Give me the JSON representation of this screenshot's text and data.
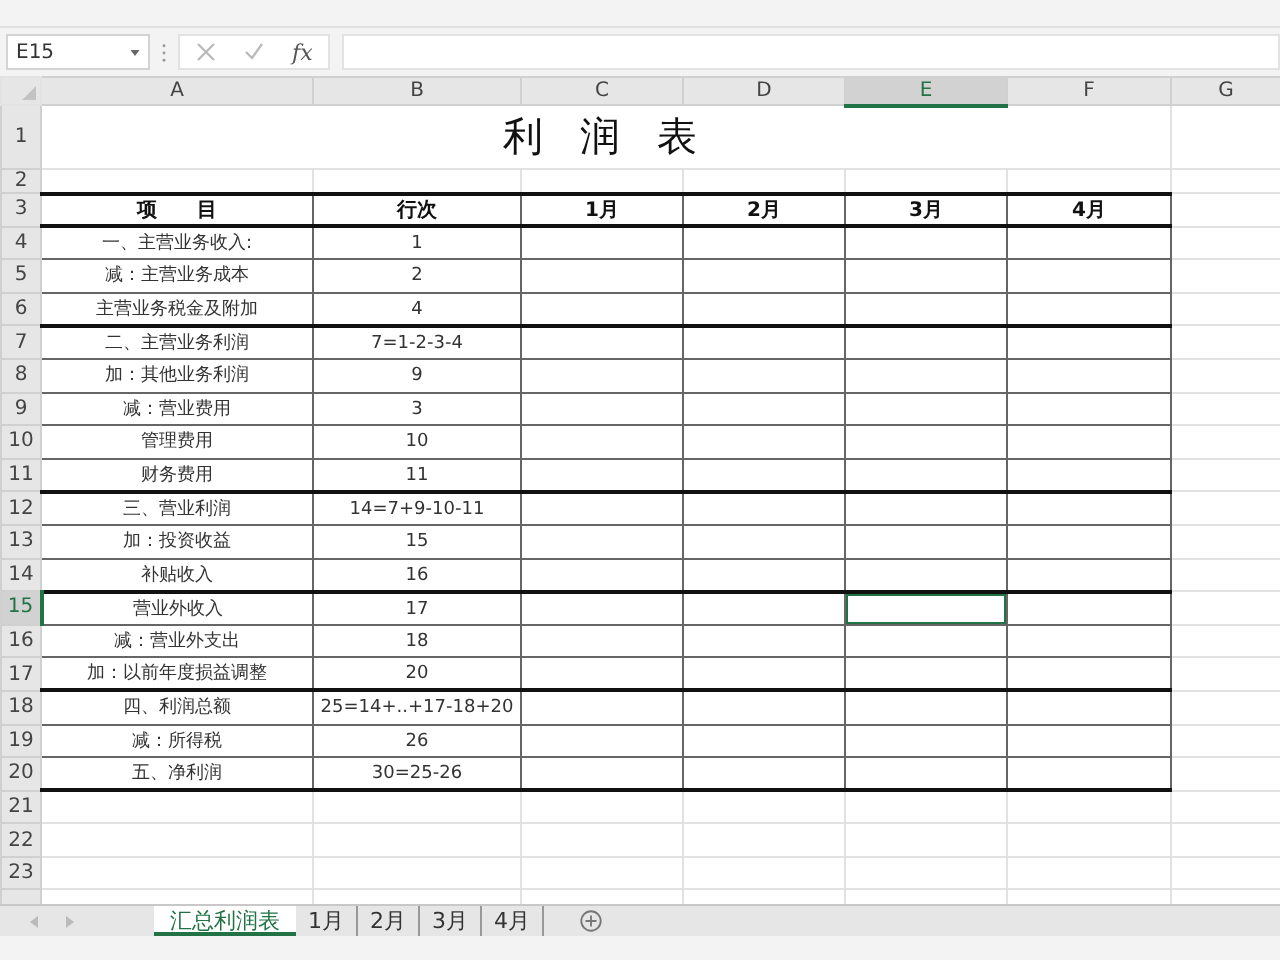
{
  "name_box": {
    "value": "E15"
  },
  "formula_bar": {
    "function_label": "fx"
  },
  "columns": [
    {
      "label": "A",
      "selected": false
    },
    {
      "label": "B",
      "selected": false
    },
    {
      "label": "C",
      "selected": false
    },
    {
      "label": "D",
      "selected": false
    },
    {
      "label": "E",
      "selected": true
    },
    {
      "label": "F",
      "selected": false
    },
    {
      "label": "G",
      "selected": false
    }
  ],
  "row_headers": [
    {
      "label": "1",
      "selected": false
    },
    {
      "label": "2",
      "selected": false
    },
    {
      "label": "3",
      "selected": false
    },
    {
      "label": "4",
      "selected": false
    },
    {
      "label": "5",
      "selected": false
    },
    {
      "label": "6",
      "selected": false
    },
    {
      "label": "7",
      "selected": false
    },
    {
      "label": "8",
      "selected": false
    },
    {
      "label": "9",
      "selected": false
    },
    {
      "label": "10",
      "selected": false
    },
    {
      "label": "11",
      "selected": false
    },
    {
      "label": "12",
      "selected": false
    },
    {
      "label": "13",
      "selected": false
    },
    {
      "label": "14",
      "selected": false
    },
    {
      "label": "15",
      "selected": true
    },
    {
      "label": "16",
      "selected": false
    },
    {
      "label": "17",
      "selected": false
    },
    {
      "label": "18",
      "selected": false
    },
    {
      "label": "19",
      "selected": false
    },
    {
      "label": "20",
      "selected": false
    },
    {
      "label": "21",
      "selected": false
    },
    {
      "label": "22",
      "selected": false
    },
    {
      "label": "23",
      "selected": false
    }
  ],
  "sheet": {
    "title": "利 润 表",
    "header": [
      "项　　目",
      "行次",
      "1月",
      "2月",
      "3月",
      "4月"
    ],
    "items": [
      {
        "label": "一、主营业务收入:",
        "line": "1",
        "border_top": true
      },
      {
        "label": "减：主营业务成本",
        "line": "2",
        "border_top": false
      },
      {
        "label": "主营业务税金及附加",
        "line": "4",
        "border_top": false
      },
      {
        "label": "二、主营业务利润",
        "line": "7=1-2-3-4",
        "border_top": true
      },
      {
        "label": "加：其他业务利润",
        "line": "9",
        "border_top": false
      },
      {
        "label": "减：营业费用",
        "line": "3",
        "border_top": false
      },
      {
        "label": "管理费用",
        "line": "10",
        "border_top": false
      },
      {
        "label": "财务费用",
        "line": "11",
        "border_top": false
      },
      {
        "label": "三、营业利润",
        "line": "14=7+9-10-11",
        "border_top": true
      },
      {
        "label": "加：投资收益",
        "line": "15",
        "border_top": false
      },
      {
        "label": "补贴收入",
        "line": "16",
        "border_top": false
      },
      {
        "label": "营业外收入",
        "line": "17",
        "border_top": true
      },
      {
        "label": "减：营业外支出",
        "line": "18",
        "border_top": false
      },
      {
        "label": "加：以前年度损益调整",
        "line": "20",
        "border_top": false
      },
      {
        "label": "四、利润总额",
        "line": "25=14+..+17-18+20",
        "border_top": true
      },
      {
        "label": "减：所得税",
        "line": "26",
        "border_top": false
      },
      {
        "label": "五、净利润",
        "line": "30=25-26",
        "border_top": false
      }
    ]
  },
  "sheet_tabs": [
    {
      "label": "汇总利润表",
      "selected": true
    },
    {
      "label": "1月",
      "selected": false
    },
    {
      "label": "2月",
      "selected": false
    },
    {
      "label": "3月",
      "selected": false
    },
    {
      "label": "4月",
      "selected": false
    }
  ]
}
